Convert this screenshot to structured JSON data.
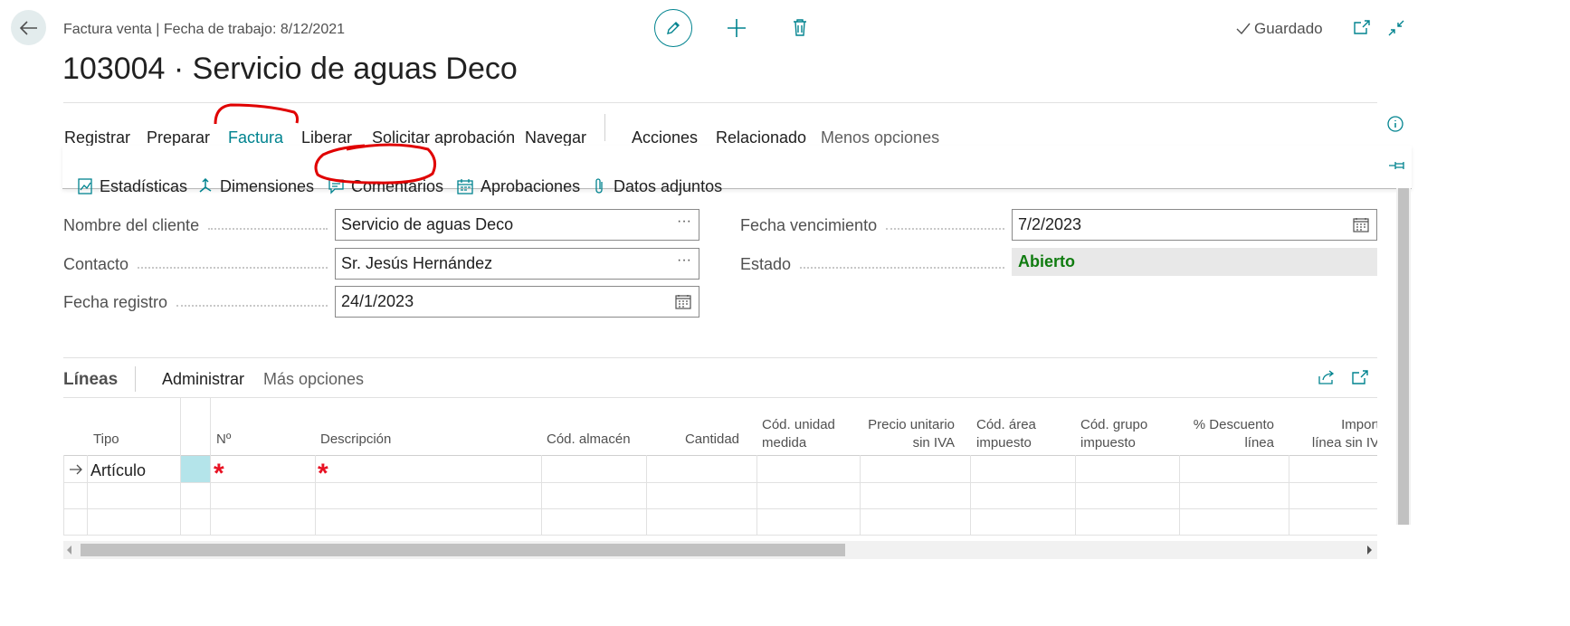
{
  "header": {
    "caption": "Factura venta | Fecha de trabajo: 8/12/2021",
    "title": "103004 · Servicio de aguas Deco",
    "saved_label": "Guardado"
  },
  "nav": {
    "items": [
      "Registrar",
      "Preparar",
      "Factura",
      "Liberar",
      "Solicitar aprobación",
      "Navegar",
      "Acciones",
      "Relacionado",
      "Menos opciones"
    ]
  },
  "subnav": {
    "items": [
      "Estadísticas",
      "Dimensiones",
      "Comentarios",
      "Aprobaciones",
      "Datos adjuntos"
    ]
  },
  "form": {
    "customer_name_label": "Nombre del cliente",
    "customer_name_value": "Servicio de aguas Deco",
    "contact_label": "Contacto",
    "contact_value": "Sr. Jesús Hernández",
    "posting_date_label": "Fecha registro",
    "posting_date_value": "24/1/2023",
    "due_date_label": "Fecha vencimiento",
    "due_date_value": "7/2/2023",
    "status_label": "Estado",
    "status_value": "Abierto",
    "ellipsis": "···"
  },
  "lines": {
    "title": "Líneas",
    "manage_label": "Administrar",
    "more_label": "Más opciones",
    "columns": [
      "Tipo",
      "Nº",
      "Descripción",
      "Cód. almacén",
      "Cantidad",
      "Cód. unidad medida",
      "Precio unitario sin IVA",
      "Cód. área impuesto",
      "Cód. grupo impuesto",
      "% Descuento línea",
      "Importe línea sin IVA"
    ],
    "rows": [
      {
        "tipo": "Artículo",
        "no": "*",
        "descripcion": "*"
      }
    ]
  },
  "colors": {
    "accent": "#00838f",
    "status_green": "#107c10",
    "required_red": "#e81123",
    "annotation_red": "#e00000"
  }
}
